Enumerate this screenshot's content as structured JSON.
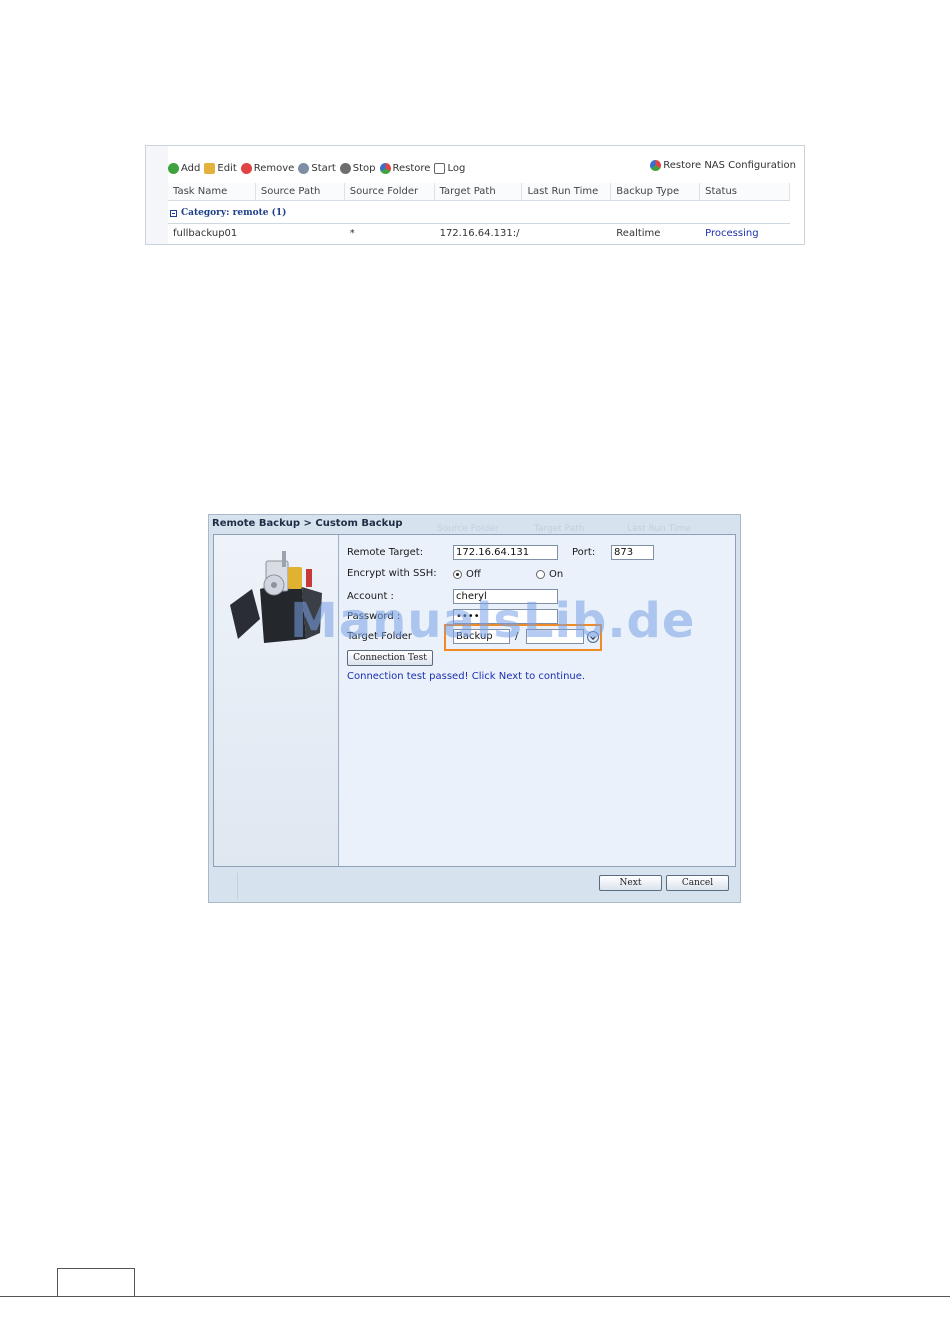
{
  "task_list": {
    "toolbar": {
      "add": "Add",
      "edit": "Edit",
      "remove": "Remove",
      "start": "Start",
      "stop": "Stop",
      "restore": "Restore",
      "log": "Log",
      "restore_nas": "Restore NAS Configuration"
    },
    "columns": [
      "Task Name",
      "Source Path",
      "Source Folder",
      "Target Path",
      "Last Run Time",
      "Backup Type",
      "Status"
    ],
    "category": "Category: remote (1)",
    "rows": [
      {
        "task_name": "fullbackup01",
        "source_path": "",
        "source_folder": "*",
        "target_path": "172.16.64.131:/",
        "last_run_time": "",
        "backup_type": "Realtime",
        "status": "Processing"
      }
    ]
  },
  "wizard": {
    "title": "Remote Backup > Custom Backup",
    "ghost_headers": [
      "Source Folder",
      "Target Path",
      "Last Run Time"
    ],
    "remote_target_label": "Remote Target:",
    "remote_target_value": "172.16.64.131",
    "port_label": "Port:",
    "port_value": "873",
    "encrypt_label": "Encrypt with SSH:",
    "encrypt_off": "Off",
    "encrypt_on": "On",
    "encrypt_selected": "Off",
    "account_label": "Account :",
    "account_value": "cheryl",
    "password_label": "Password :",
    "password_value": "••••",
    "target_folder_label": "Target Folder",
    "target_folder_value": "Backup",
    "target_folder_separator": "/",
    "target_subfolder_value": "",
    "connection_test_button": "Connection Test",
    "connection_message": "Connection test passed! Click Next to continue.",
    "next_button": "Next",
    "cancel_button": "Cancel"
  },
  "watermark": "ManualsLib.de",
  "colors": {
    "highlight": "#f08a24",
    "link_blue": "#1a2fb0",
    "panel_bg": "#d7e2ef"
  }
}
